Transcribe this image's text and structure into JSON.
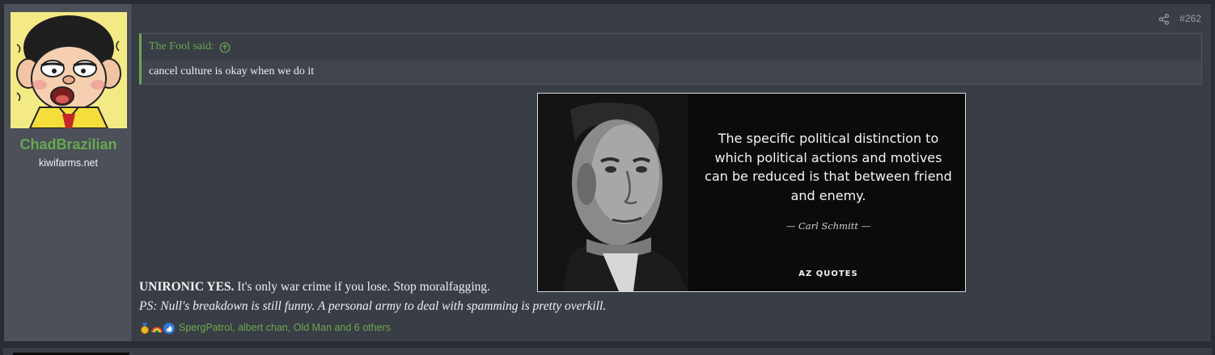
{
  "post": {
    "number": "#262",
    "author": {
      "username": "ChadBrazilian",
      "user_title": "kiwifarms.net",
      "username_color": "#6aa84f"
    },
    "quote": {
      "attribution": "The Fool said:",
      "text": "cancel culture is okay when we do it",
      "expand_icon": "arrow-up-circle-icon"
    },
    "image": {
      "quote_text": "The specific political distinction to which political actions and motives can be reduced is that between friend and enemy.",
      "attribution": "— Carl Schmitt —",
      "logo": "AZ QUOTES"
    },
    "body": {
      "line1_bold": "UNIRONIC YES.",
      "line1_rest": " It's only war crime if you lose. Stop moralfagging.",
      "line2": "PS: Null's breakdown is still funny. A personal army to deal with spamming is pretty overkill."
    },
    "reactions": {
      "icons": [
        "medal-icon",
        "rainbow-icon",
        "thumbs-up-icon"
      ],
      "text": "SpergPatrol, albert chan, Old Man and 6 others"
    },
    "share_icon": "share-icon"
  },
  "colors": {
    "accent_green": "#6aa84f",
    "post_bg": "#393d45",
    "user_col_bg": "#4b5059"
  }
}
